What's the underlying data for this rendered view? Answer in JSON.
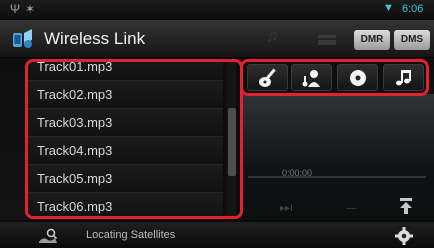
{
  "status": {
    "usb_glyph": "Ψ",
    "bt_glyph": "✶",
    "wifi_glyph": "▼",
    "time": "6:06",
    "accent": "#3fc6d8"
  },
  "header": {
    "title": "Wireless Link",
    "buttons": [
      "DMR",
      "DMS"
    ]
  },
  "tracks": [
    "Track01.mp3",
    "Track02.mp3",
    "Track03.mp3",
    "Track04.mp3",
    "Track05.mp3",
    "Track06.mp3"
  ],
  "categories": [
    {
      "icon": "guitar-icon"
    },
    {
      "icon": "artist-icon"
    },
    {
      "icon": "disc-icon"
    },
    {
      "icon": "music-note-icon"
    }
  ],
  "player": {
    "time": "0:00:00"
  },
  "bottom": {
    "status_text": "Locating Satellites"
  },
  "highlight_color": "#e2222e"
}
